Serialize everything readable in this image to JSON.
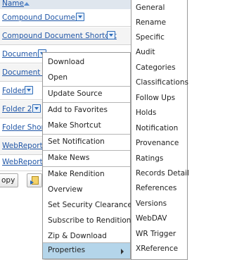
{
  "listing": {
    "header_label": "Name",
    "rows": [
      {
        "label": "Compound Document"
      },
      {
        "label": "Compound Document Shortcut"
      },
      {
        "label": "Document"
      },
      {
        "label": "Document S"
      },
      {
        "label": "Folder"
      },
      {
        "label": "Folder 2"
      },
      {
        "label": "Folder Short"
      },
      {
        "label": "WebReport"
      },
      {
        "label": "WebReport"
      }
    ],
    "copy_label": "opy"
  },
  "menu": {
    "items": [
      {
        "label": "Download"
      },
      {
        "label": "Open"
      },
      {
        "label": "Update Source"
      },
      {
        "label": "Add to Favorites"
      },
      {
        "label": "Make Shortcut"
      },
      {
        "label": "Set Notification"
      },
      {
        "label": "Make News"
      },
      {
        "label": "Make Rendition"
      },
      {
        "label": "Overview"
      },
      {
        "label": "Set Security Clearance"
      },
      {
        "label": "Subscribe to Rendition"
      },
      {
        "label": "Zip & Download"
      },
      {
        "label": "Properties"
      }
    ]
  },
  "submenu": {
    "items": [
      {
        "label": "General"
      },
      {
        "label": "Rename"
      },
      {
        "label": "Specific"
      },
      {
        "label": "Audit"
      },
      {
        "label": "Categories"
      },
      {
        "label": "Classifications"
      },
      {
        "label": "Follow Ups"
      },
      {
        "label": "Holds"
      },
      {
        "label": "Notification"
      },
      {
        "label": "Provenance"
      },
      {
        "label": "Ratings"
      },
      {
        "label": "Records Detail"
      },
      {
        "label": "References"
      },
      {
        "label": "Versions"
      },
      {
        "label": "WebDAV"
      },
      {
        "label": "WR Trigger"
      },
      {
        "label": "XReference"
      }
    ]
  },
  "colors": {
    "link": "#1f55a6",
    "highlight": "#b4d5ea",
    "header_bg": "#dfe6ee"
  },
  "icons": {
    "sort": "sort-ascending-icon",
    "dropdown": "dropdown-arrow-icon",
    "submenu": "chevron-right-icon",
    "tool": "document-icon"
  }
}
